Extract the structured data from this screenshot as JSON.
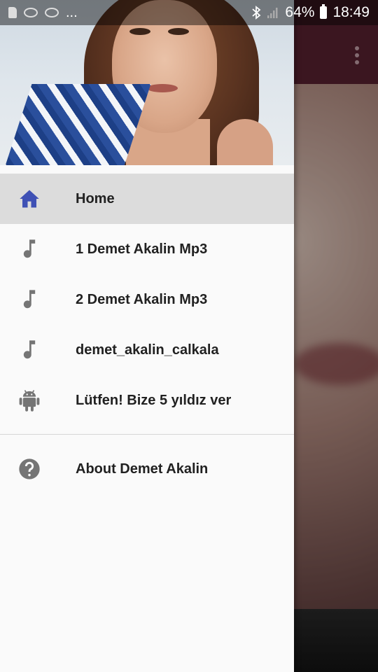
{
  "status_bar": {
    "left_ellipsis": "...",
    "battery_percent": "64%",
    "time": "18:49"
  },
  "app": {
    "toolbar_color": "#5b2232",
    "overflow_icon": "more-vert-icon"
  },
  "drawer": {
    "accent_color": "#3f51b5",
    "items": [
      {
        "label": "Home",
        "icon": "home-icon",
        "active": true
      },
      {
        "label": "1 Demet Akalin Mp3",
        "icon": "music-note-icon",
        "active": false
      },
      {
        "label": "2 Demet Akalin Mp3",
        "icon": "music-note-icon",
        "active": false
      },
      {
        "label": "demet_akalin_calkala",
        "icon": "music-note-icon",
        "active": false
      },
      {
        "label": "Lütfen! Bize 5 yıldız ver",
        "icon": "android-icon",
        "active": false
      }
    ],
    "secondary_items": [
      {
        "label": "About Demet Akalin",
        "icon": "help-icon",
        "active": false
      }
    ]
  }
}
